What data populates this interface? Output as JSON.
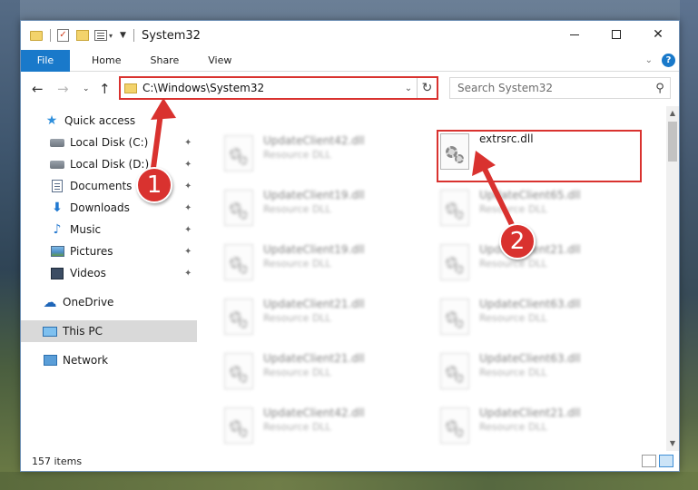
{
  "window": {
    "title": "System32"
  },
  "ribbon": {
    "tabs": [
      "File",
      "Home",
      "Share",
      "View"
    ]
  },
  "nav": {
    "address": "C:\\Windows\\System32",
    "search_placeholder": "Search System32"
  },
  "sidebar": {
    "items": [
      {
        "label": "Quick access",
        "icon": "star-icon"
      },
      {
        "label": "Local Disk (C:)",
        "icon": "disk-icon"
      },
      {
        "label": "Local Disk (D:)",
        "icon": "disk-icon"
      },
      {
        "label": "Documents",
        "icon": "documents-icon"
      },
      {
        "label": "Downloads",
        "icon": "download-arrow-icon"
      },
      {
        "label": "Music",
        "icon": "music-note-icon"
      },
      {
        "label": "Pictures",
        "icon": "pictures-icon"
      },
      {
        "label": "Videos",
        "icon": "video-film-icon"
      },
      {
        "label": "OneDrive",
        "icon": "cloud-icon"
      },
      {
        "label": "This PC",
        "icon": "computer-icon"
      },
      {
        "label": "Network",
        "icon": "network-icon"
      }
    ]
  },
  "files": {
    "highlighted": {
      "name": "extrsrc.dll"
    },
    "left_column": [
      {
        "name": "UpdateClient42.dll",
        "type": "Resource DLL"
      },
      {
        "name": "UpdateClient19.dll",
        "type": "Resource DLL"
      },
      {
        "name": "UpdateClient19.dll",
        "type": "Resource DLL"
      },
      {
        "name": "UpdateClient21.dll",
        "type": "Resource DLL"
      },
      {
        "name": "UpdateClient21.dll",
        "type": "Resource DLL"
      },
      {
        "name": "UpdateClient42.dll",
        "type": "Resource DLL"
      }
    ],
    "right_column": [
      {
        "name": "UpdateClient65.dll",
        "type": "Resource DLL"
      },
      {
        "name": "UpdateClient21.dll",
        "type": "Resource DLL"
      },
      {
        "name": "UpdateClient63.dll",
        "type": "Resource DLL"
      },
      {
        "name": "UpdateClient63.dll",
        "type": "Resource DLL"
      },
      {
        "name": "UpdateClient21.dll",
        "type": "Resource DLL"
      }
    ]
  },
  "status": {
    "item_count": "157 items"
  },
  "callouts": [
    "1",
    "2"
  ],
  "colors": {
    "accent": "#1979ca",
    "highlight": "#d9322f"
  }
}
